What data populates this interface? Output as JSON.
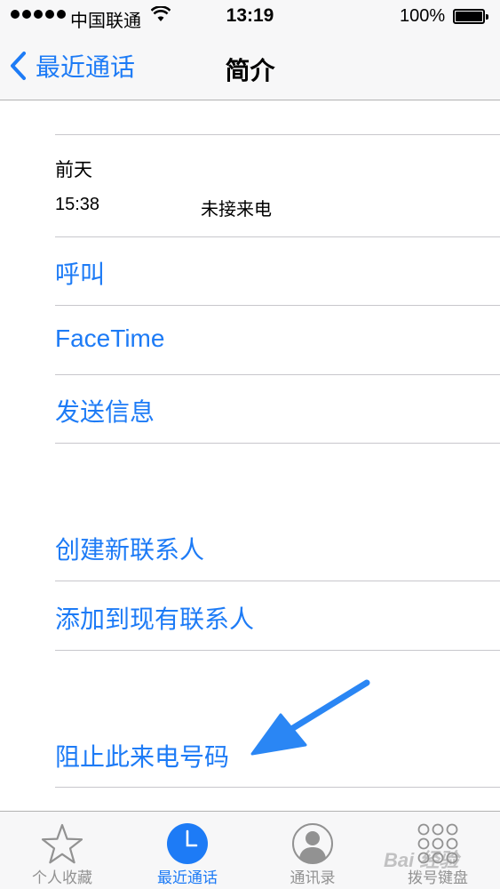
{
  "status_bar": {
    "carrier": "中国联通",
    "time": "13:19",
    "battery": "100%",
    "signal_dots": 5,
    "battery_level": 1.0
  },
  "nav": {
    "back_label": "最近通话",
    "title": "简介"
  },
  "call_info": {
    "date": "前天",
    "time": "15:38",
    "status": "未接来电"
  },
  "actions": {
    "call": "呼叫",
    "facetime": "FaceTime",
    "send_message": "发送信息",
    "create_contact": "创建新联系人",
    "add_to_existing": "添加到现有联系人",
    "block_caller": "阻止此来电号码"
  },
  "tabs": [
    {
      "label": "个人收藏",
      "icon": "star-icon",
      "active": false
    },
    {
      "label": "最近通话",
      "icon": "clock-icon",
      "active": true
    },
    {
      "label": "通讯录",
      "icon": "contacts-icon",
      "active": false
    },
    {
      "label": "拨号键盘",
      "icon": "keypad-icon",
      "active": false
    }
  ],
  "watermark": "Bai 经验",
  "colors": {
    "accent": "#1d7bf6",
    "inactive": "#929292",
    "separator": "#c8c7cc",
    "bar_background": "#f7f7f8"
  }
}
